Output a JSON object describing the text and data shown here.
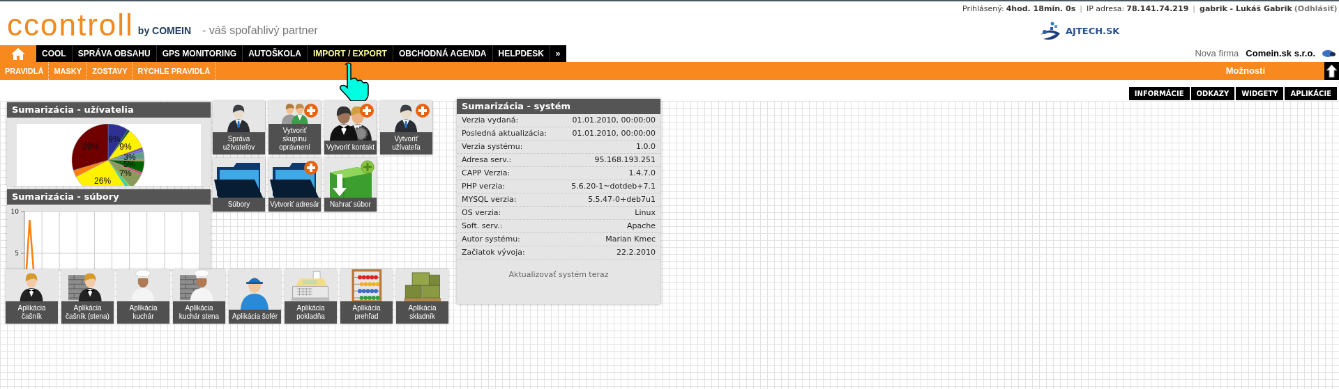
{
  "header": {
    "logo": "ccontroll",
    "logo_by": "by COMEIN",
    "tagline": "- váš spoľahlivý partner",
    "partner_logo": "AJTECH.SK"
  },
  "session_bar": [
    {
      "kind": "field",
      "label": "Prihlásený:",
      "value": "4hod. 18min. 0s"
    },
    {
      "kind": "separator",
      "text": "|"
    },
    {
      "kind": "field",
      "label": "IP adresa:",
      "value": "78.141.74.219"
    },
    {
      "kind": "separator",
      "text": "|"
    },
    {
      "kind": "user",
      "name": "gabrik - Lukáš Gabrik",
      "logout": "(Odhlásiť)"
    }
  ],
  "nav": [
    {
      "kind": "home",
      "selected": true,
      "highlighted": false
    },
    {
      "kind": "item",
      "label": "COOL",
      "selected": false,
      "highlighted": false
    },
    {
      "kind": "item",
      "label": "SPRÁVA OBSAHU",
      "selected": false,
      "highlighted": false
    },
    {
      "kind": "item",
      "label": "GPS MONITORING",
      "selected": false,
      "highlighted": false
    },
    {
      "kind": "item",
      "label": "AUTOŠKOLA",
      "selected": false,
      "highlighted": false
    },
    {
      "kind": "item",
      "label": "IMPORT / EXPORT",
      "selected": false,
      "highlighted": true
    },
    {
      "kind": "item",
      "label": "OBCHODNÁ AGENDA",
      "selected": false,
      "highlighted": false
    },
    {
      "kind": "item",
      "label": "HELPDESK",
      "selected": false,
      "highlighted": false
    },
    {
      "kind": "item",
      "label": "»",
      "selected": false,
      "highlighted": false
    }
  ],
  "company": {
    "label": "Nova firma",
    "name": "Comein.sk s.r.o."
  },
  "subnav": [
    {
      "label": "PRAVIDLÁ"
    },
    {
      "label": "MASKY"
    },
    {
      "label": "ZOSTAVY"
    },
    {
      "label": "RÝCHLE PRAVIDLÁ"
    }
  ],
  "options_bar": {
    "title": "Možnosti"
  },
  "tabs": [
    {
      "label": "INFORMÁCIE",
      "selected": false
    },
    {
      "label": "ODKAZY",
      "selected": false
    },
    {
      "label": "WIDGETY",
      "selected": false
    },
    {
      "label": "APLIKÁCIE",
      "selected": false
    }
  ],
  "users_panel": {
    "title": "Sumarizácia - užívatelia",
    "chart_data": {
      "type": "pie",
      "values": [
        9,
        1,
        9,
        1,
        1,
        3,
        1,
        5,
        1,
        7,
        1,
        1,
        26,
        3,
        29
      ],
      "value_labels": [
        "9%",
        null,
        "9%",
        null,
        null,
        "3%",
        null,
        "5%",
        null,
        "7%",
        null,
        null,
        "26%",
        null,
        "29%"
      ]
    }
  },
  "files_panel": {
    "title": "Sumarizácia - súbory",
    "chart": {
      "kind": "picture",
      "axis_labels": [
        "10",
        "5"
      ]
    }
  },
  "tiles": [
    {
      "kind": "manager",
      "label": "Správa užívateľov",
      "add": false
    },
    {
      "kind": "group",
      "label": "Vytvoriť skupinu oprávnení",
      "add": true
    },
    {
      "kind": "contacts",
      "label": "Vytvoriť kontakt",
      "add": true
    },
    {
      "kind": "manager",
      "label": "Vytvoriť užívateľa",
      "add": true
    },
    {
      "kind": "folder",
      "label": "Súbory",
      "add": false
    },
    {
      "kind": "folder",
      "label": "Vytvoriť adresár",
      "add": true
    },
    {
      "kind": "upload",
      "label": "Nahrať súbor",
      "add": false
    }
  ],
  "apps": [
    {
      "kind": "waiter",
      "label": "Aplikácia čašník",
      "wall": false
    },
    {
      "kind": "waiter",
      "label": "Aplikácia čašník (stena)",
      "wall": true
    },
    {
      "kind": "chef",
      "label": "Aplikácia kuchár",
      "wall": false
    },
    {
      "kind": "chef",
      "label": "Aplikácia kuchár stena",
      "wall": true
    },
    {
      "kind": "driver",
      "label": "Aplikácia šofér",
      "wall": false
    },
    {
      "kind": "register",
      "label": "Aplikácia pokladňa",
      "wall": false
    },
    {
      "kind": "abacus",
      "label": "Aplikácia prehľad",
      "wall": false
    },
    {
      "kind": "boxes",
      "label": "Aplikácia skladník",
      "wall": false
    }
  ],
  "system_panel": {
    "title": "Sumarizácia - systém",
    "rows": [
      {
        "label": "Verzia vydaná:",
        "value": "01.01.2010, 00:00:00"
      },
      {
        "label": "Posledná aktualizácia:",
        "value": "01.01.2010, 00:00:00"
      },
      {
        "label": "Verzia systému:",
        "value": "1.0.0"
      },
      {
        "label": "Adresa serv.:",
        "value": "95.168.193.251"
      },
      {
        "label": "CAPP Verzia:",
        "value": "1.4.7.0"
      },
      {
        "label": "PHP verzia:",
        "value": "5.6.20-1~dotdeb+7.1"
      },
      {
        "label": "MYSQL verzia:",
        "value": "5.5.47-0+deb7u1"
      },
      {
        "label": "OS verzia:",
        "value": "Linux"
      },
      {
        "label": "Soft. serv.:",
        "value": "Apache"
      },
      {
        "label": "Autor systému:",
        "value": "Marian Kmec"
      },
      {
        "label": "Začiatok vývoja:",
        "value": "22.2.2010"
      }
    ],
    "action": "Aktualizovať systém teraz"
  }
}
